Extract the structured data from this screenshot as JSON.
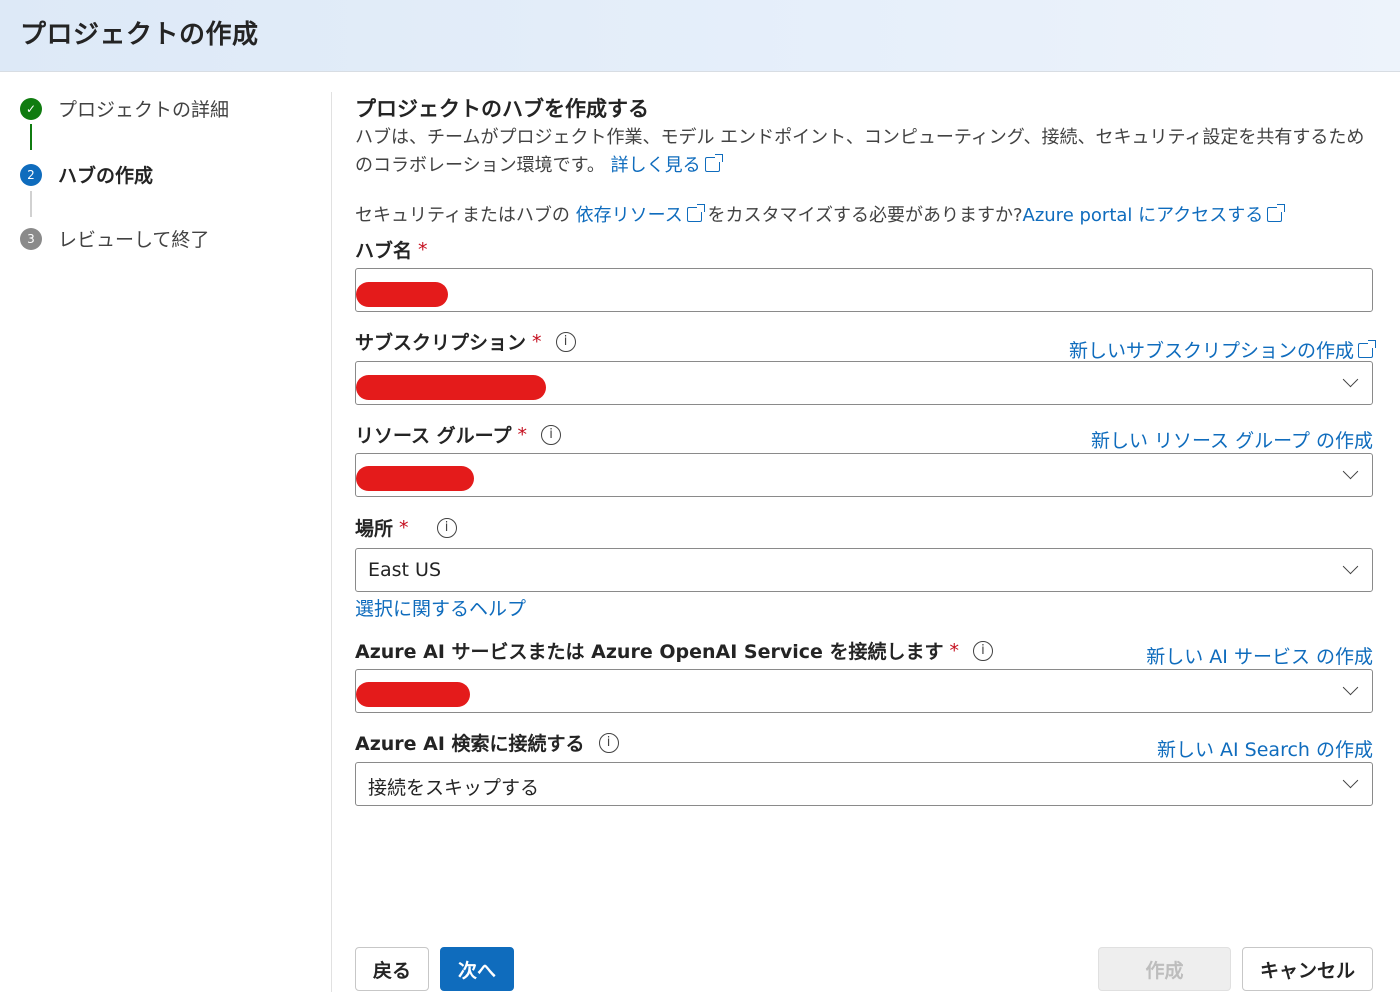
{
  "header": {
    "title": "プロジェクトの作成"
  },
  "steps": [
    {
      "label": "プロジェクトの詳細",
      "status": "done",
      "marker": "✓"
    },
    {
      "label": "ハブの作成",
      "status": "current",
      "marker": "2"
    },
    {
      "label": "レビューして終了",
      "status": "todo",
      "marker": "3"
    }
  ],
  "section": {
    "title": "プロジェクトのハブを作成する",
    "description": "ハブは、チームがプロジェクト作業、モデル エンドポイント、コンピューティング、接続、セキュリティ設定を共有するためのコラボレーション環境です。",
    "learn_more": "詳しく見る",
    "note_prefix": "セキュリティまたはハブの",
    "note_link": "依存リソース",
    "note_middle": "をカスタマイズする必要がありますか?",
    "note_portal_link": "Azure portal にアクセスする"
  },
  "fields": {
    "hub_name": {
      "label": "ハブ名",
      "required": "*",
      "value": ""
    },
    "subscription": {
      "label": "サブスクリプション",
      "required": "*",
      "info": "i",
      "link": "新しいサブスクリプションの作成",
      "value": ""
    },
    "resource_group": {
      "label": "リソース グループ",
      "required": "*",
      "info": "i",
      "link": "新しい リソース グループ の作成",
      "value": ""
    },
    "location": {
      "label": "場所",
      "required": "*",
      "info": "i",
      "value": "East US",
      "help": "選択に関するヘルプ"
    },
    "ai_services": {
      "label": "Azure AI サービスまたは Azure OpenAI Service を接続します",
      "required": "*",
      "info": "i",
      "link": "新しい AI サービス の作成",
      "value": ""
    },
    "ai_search": {
      "label": "Azure AI 検索に接続する",
      "info": "i",
      "link": "新しい AI Search の作成",
      "value": "接続をスキップする"
    }
  },
  "buttons": {
    "back": "戻る",
    "next": "次へ",
    "create": "作成",
    "cancel": "キャンセル"
  },
  "colors": {
    "accent": "#0f6cbd",
    "success": "#107c10",
    "required": "#c50f1f",
    "redaction": "#e41b1b"
  }
}
